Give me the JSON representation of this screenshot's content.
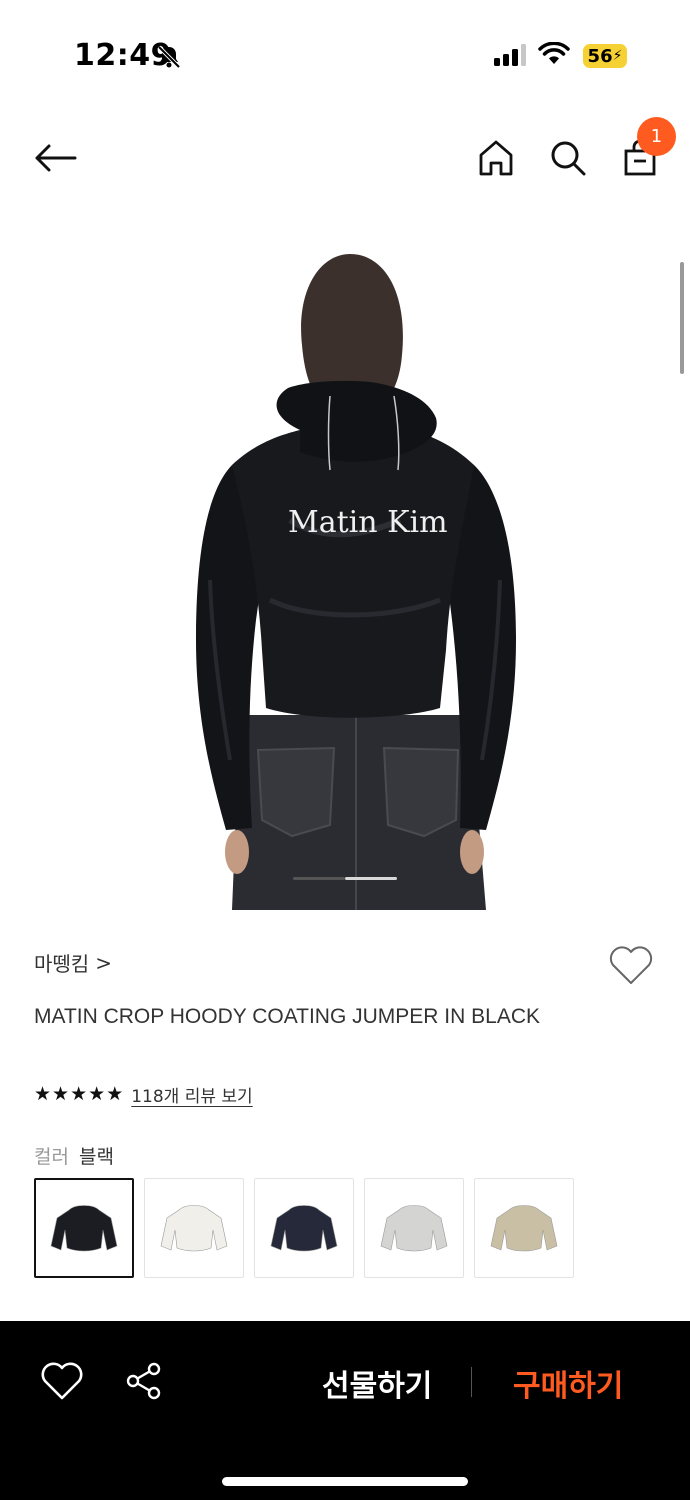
{
  "status_bar": {
    "time": "12:49",
    "battery": "56",
    "icons": [
      "bell-slash-icon",
      "signal-icon",
      "wifi-icon",
      "battery-charging-icon"
    ]
  },
  "nav": {
    "icons": [
      "back-arrow-icon",
      "home-icon",
      "search-icon",
      "shopping-bag-icon"
    ],
    "cart_badge": "1",
    "badge_color": "#ff5a1f"
  },
  "hero": {
    "jacket_print": "Matin Kim",
    "page_indicator": {
      "count": 2,
      "current": 2
    }
  },
  "product": {
    "brand": "마뗑킴",
    "brand_chevron": ">",
    "title": "MATIN CROP HOODY COATING JUMPER IN BLACK",
    "rating": {
      "stars": 5,
      "review_link": "118개 리뷰 보기"
    },
    "color_label": "컬러",
    "color_value": "블랙",
    "swatches": [
      {
        "name": "black",
        "color": "#1b1d22",
        "selected": true
      },
      {
        "name": "ivory",
        "color": "#f1efe9",
        "selected": false
      },
      {
        "name": "navy",
        "color": "#26293a",
        "selected": false
      },
      {
        "name": "light-gray",
        "color": "#d4d4d2",
        "selected": false
      },
      {
        "name": "beige",
        "color": "#c9bfa5",
        "selected": false
      }
    ]
  },
  "bottom_bar": {
    "gift_label": "선물하기",
    "buy_label": "구매하기",
    "buy_color": "#ff5a1f",
    "icons": [
      "heart-outline-icon",
      "share-icon"
    ]
  }
}
